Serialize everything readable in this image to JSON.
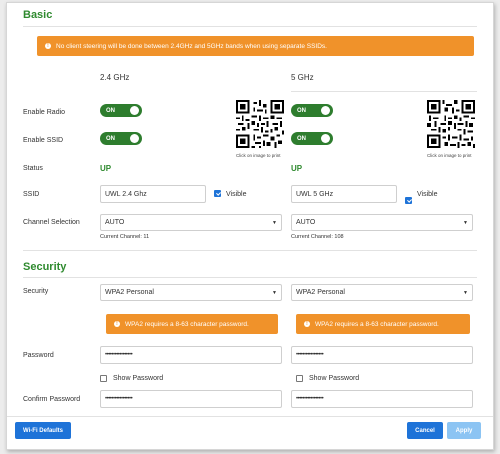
{
  "basic": {
    "title": "Basic",
    "notice": "No client steering will be done between 2.4GHz and 5GHz bands when using separate SSIDs.",
    "labels": {
      "enable_radio": "Enable Radio",
      "enable_ssid": "Enable SSID",
      "status": "Status",
      "ssid": "SSID",
      "channel": "Channel Selection"
    },
    "qr_caption": "Click on image to print",
    "band_24": {
      "header": "2.4 GHz",
      "radio": "ON",
      "ssid_enabled": "ON",
      "status": "UP",
      "ssid": "UWL 2.4 Ghz",
      "visible_label": "Visible",
      "channel": "AUTO",
      "current_channel": "Current Channel: 11"
    },
    "band_5": {
      "header": "5 GHz",
      "radio": "ON",
      "ssid_enabled": "ON",
      "status": "UP",
      "ssid": "UWL 5 GHz",
      "visible_label": "Visible",
      "channel": "AUTO",
      "current_channel": "Current Channel: 108"
    }
  },
  "security": {
    "title": "Security",
    "labels": {
      "security": "Security",
      "password": "Password",
      "confirm": "Confirm Password"
    },
    "band_24": {
      "mode": "WPA2 Personal",
      "warning": "WPA2 requires a 8-63 character password.",
      "password": "•••••••••••••••••",
      "show_password": "Show Password",
      "confirm": "•••••••••••••••••"
    },
    "band_5": {
      "mode": "WPA2 Personal",
      "warning": "WPA2 requires a 8-63 character password.",
      "password": "•••••••••••••••••",
      "show_password": "Show Password",
      "confirm": "•••••••••••••••••"
    }
  },
  "footer": {
    "defaults": "Wi-Fi Defaults",
    "cancel": "Cancel",
    "apply": "Apply"
  },
  "colors": {
    "accent_green": "#2f8a2f",
    "toggle_green": "#2e7d2e",
    "warning_orange": "#f0922a",
    "primary_blue": "#1e73d8",
    "apply_disabled": "#8cc4f3"
  }
}
